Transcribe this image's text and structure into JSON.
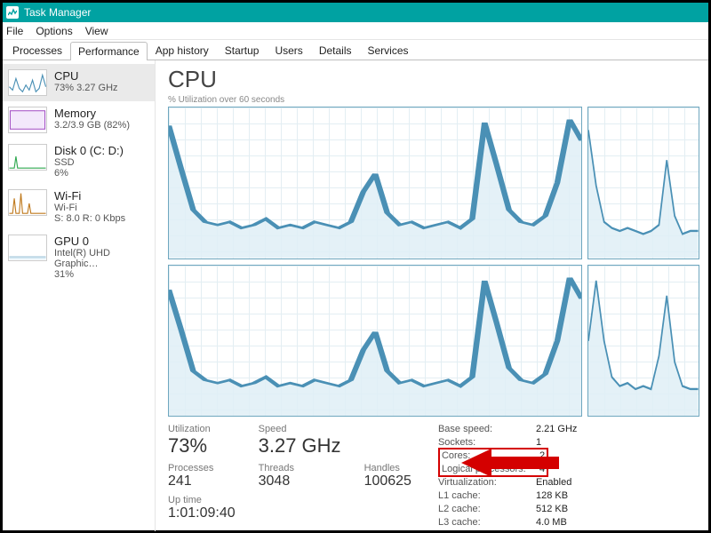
{
  "window": {
    "title": "Task Manager"
  },
  "menu": {
    "file": "File",
    "options": "Options",
    "view": "View"
  },
  "tabs": {
    "items": [
      {
        "label": "Processes"
      },
      {
        "label": "Performance"
      },
      {
        "label": "App history"
      },
      {
        "label": "Startup"
      },
      {
        "label": "Users"
      },
      {
        "label": "Details"
      },
      {
        "label": "Services"
      }
    ],
    "active_index": 1
  },
  "sidebar": {
    "items": [
      {
        "title": "CPU",
        "line2": "73%  3.27 GHz",
        "line3": "",
        "color": "#4a90b5",
        "selected": true
      },
      {
        "title": "Memory",
        "line2": "3.2/3.9 GB (82%)",
        "line3": "",
        "color": "#9b3fbf"
      },
      {
        "title": "Disk 0 (C: D:)",
        "line2": "SSD",
        "line3": "6%",
        "color": "#2fa84f"
      },
      {
        "title": "Wi-Fi",
        "line2": "Wi-Fi",
        "line3": "S: 8.0  R: 0 Kbps",
        "color": "#c07a1e"
      },
      {
        "title": "GPU 0",
        "line2": "Intel(R) UHD Graphic…",
        "line3": "31%",
        "color": "#4a90b5"
      }
    ]
  },
  "main": {
    "heading": "CPU",
    "chart_caption": "% Utilization over 60 seconds"
  },
  "stats": {
    "utilization_label": "Utilization",
    "utilization": "73%",
    "speed_label": "Speed",
    "speed": "3.27 GHz",
    "processes_label": "Processes",
    "processes": "241",
    "threads_label": "Threads",
    "threads": "3048",
    "handles_label": "Handles",
    "handles": "100625",
    "uptime_label": "Up time",
    "uptime": "1:01:09:40",
    "right": {
      "base_speed_k": "Base speed:",
      "base_speed_v": "2.21 GHz",
      "sockets_k": "Sockets:",
      "sockets_v": "1",
      "cores_k": "Cores:",
      "cores_v": "2",
      "logical_k": "Logical processors:",
      "logical_v": "4",
      "virt_k": "Virtualization:",
      "virt_v": "Enabled",
      "l1_k": "L1 cache:",
      "l1_v": "128 KB",
      "l2_k": "L2 cache:",
      "l2_v": "512 KB",
      "l3_k": "L3 cache:",
      "l3_v": "4.0 MB"
    }
  },
  "chart_data": {
    "type": "line",
    "xlabel": "seconds",
    "ylabel": "% utilization",
    "ylim": [
      0,
      100
    ],
    "series": [
      {
        "name": "core0_big",
        "values": [
          88,
          60,
          32,
          24,
          22,
          24,
          20,
          22,
          26,
          20,
          22,
          20,
          24,
          22,
          20,
          24,
          44,
          56,
          30,
          22,
          24,
          20,
          22,
          24,
          20,
          26,
          90,
          62,
          32,
          24,
          22,
          28,
          50,
          92,
          78
        ]
      },
      {
        "name": "core0_small",
        "values": [
          85,
          48,
          24,
          20,
          18,
          20,
          18,
          16,
          18,
          22,
          65,
          28,
          16,
          18,
          18
        ]
      },
      {
        "name": "core1_big",
        "values": [
          84,
          58,
          30,
          24,
          22,
          24,
          20,
          22,
          26,
          20,
          22,
          20,
          24,
          22,
          20,
          24,
          44,
          56,
          30,
          22,
          24,
          20,
          22,
          24,
          20,
          26,
          90,
          62,
          32,
          24,
          22,
          28,
          50,
          92,
          78
        ]
      },
      {
        "name": "core1_small",
        "values": [
          50,
          90,
          50,
          26,
          20,
          22,
          18,
          20,
          18,
          40,
          80,
          36,
          20,
          18,
          18
        ]
      }
    ]
  }
}
